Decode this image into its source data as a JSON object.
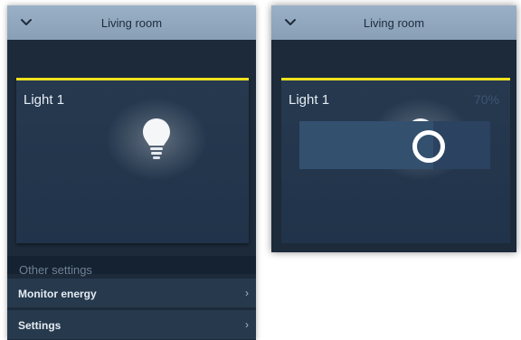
{
  "left_panel": {
    "header": {
      "title": "Living room",
      "collapse_icon": "chevron-down-icon"
    },
    "card": {
      "label": "Light 1",
      "accent_color": "#f1e21e",
      "icon": "lightbulb-icon"
    },
    "other_settings": {
      "title": "Other settings",
      "items": [
        {
          "label": "Monitor energy",
          "arrow": "›"
        },
        {
          "label": "Settings",
          "arrow": "›"
        }
      ]
    }
  },
  "right_panel": {
    "header": {
      "title": "Living room",
      "collapse_icon": "chevron-down-icon"
    },
    "card": {
      "label": "Light 1",
      "brightness_text": "70%",
      "brightness_level": 0.7,
      "accent_color": "#f1e21e",
      "icon": "lightbulb-icon"
    }
  }
}
